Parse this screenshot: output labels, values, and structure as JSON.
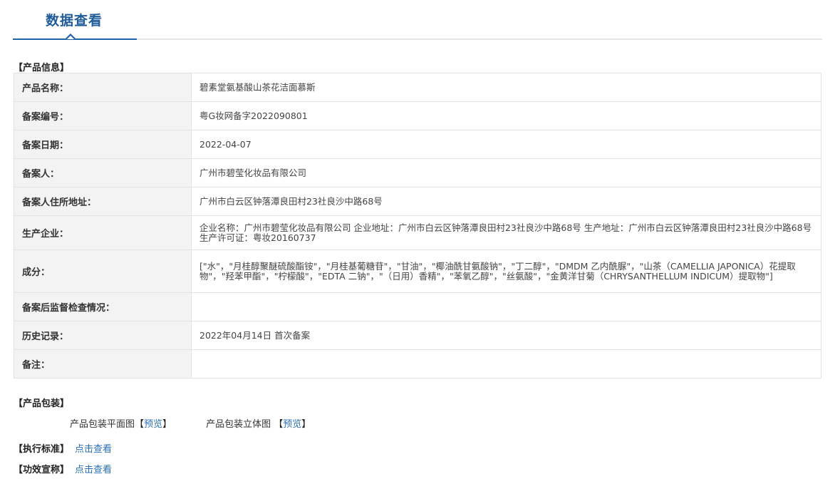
{
  "header": {
    "title": "数据查看"
  },
  "sections": {
    "product_info": "【产品信息】",
    "packaging": "【产品包装】",
    "standard": "【执行标准】",
    "efficacy": "【功效宣称】"
  },
  "links": {
    "standard_view": "点击查看",
    "efficacy_view": "点击查看"
  },
  "table": {
    "rows": [
      {
        "label": "产品名称：",
        "value": "碧素堂氨基酸山茶花洁面慕斯"
      },
      {
        "label": "备案编号：",
        "value": "粤G妆网备字2022090801"
      },
      {
        "label": "备案日期：",
        "value": "2022-04-07"
      },
      {
        "label": "备案人：",
        "value": "广州市碧莹化妆品有限公司"
      },
      {
        "label": "备案人住所地址：",
        "value": "广州市白云区钟落潭良田村23社良沙中路68号"
      },
      {
        "label": "生产企业：",
        "value": "企业名称：广州市碧莹化妆品有限公司 企业地址：广州市白云区钟落潭良田村23社良沙中路68号 生产地址：广州市白云区钟落潭良田村23社良沙中路68号 生产许可证：粤妆20160737"
      },
      {
        "label": "成分：",
        "value": "[\"水\"，\"月桂醇聚醚硫酸酯铵\"，\"月桂基葡糖苷\"，\"甘油\"，\"椰油酰甘氨酸钠\"，\"丁二醇\"，\"DMDM 乙内酰脲\"，\"山茶（CAMELLIA JAPONICA）花提取物\"，\"羟苯甲酯\"，\"柠檬酸\"，\"EDTA 二钠\"，\"（日用）香精\"，\"苯氧乙醇\"，\"丝氨酸\"，\"金黄洋甘菊（CHRYSANTHELLUM INDICUM）提取物\"]"
      },
      {
        "label": "备案后监督检查情况：",
        "value": ""
      },
      {
        "label": "历史记录：",
        "value": "2022年04月14日 首次备案"
      },
      {
        "label": "备注：",
        "value": ""
      }
    ]
  },
  "packaging": {
    "flat_label": "产品包装平面图",
    "flat_preview": "预览",
    "stereo_label": "产品包装立体图",
    "stereo_preview": "预览",
    "open_bracket": "【",
    "close_bracket": "】"
  },
  "colors": {
    "accent": "#1f63a8",
    "link": "#2a6fb5",
    "table_border": "#a9c1dc",
    "label_bg": "#f3f3f3"
  }
}
